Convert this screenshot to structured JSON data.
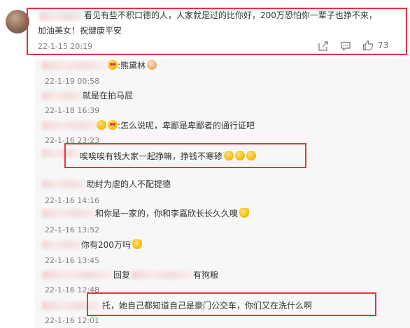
{
  "main_comment": {
    "text_line1": "看见有些不积口德的人，人家就是过的比你好，200万恐怕你一辈子也挣不来，",
    "text_line2": "加油美女！祝健康平安",
    "time": "22-1-15 20:19",
    "like_count": "73"
  },
  "replies": [
    {
      "text": ":熊黛林",
      "time": "22-1-19 00:58"
    },
    {
      "text": "就是在拍马屁",
      "time": "22-1-18 16:39"
    },
    {
      "text": ":怎么说呢，卑鄙是卑鄙者的通行证吧",
      "time": "22-1-16 23:23"
    },
    {
      "text": "唉唉唉有钱大家一起挣嘛，挣钱不寒碜",
      "time": ""
    },
    {
      "text": "助纣为虐的人不配提德",
      "time": "22-1-16 14:16"
    },
    {
      "text": "和你是一家的，你和李嘉欣长长久久噢",
      "time": "22-1-16 13:52"
    },
    {
      "text": "你有200万吗",
      "time": "22-1-16 13:45"
    },
    {
      "text_prefix": "回复",
      "text_suffix": "有狗粮",
      "time": "22-1-16 12:48"
    },
    {
      "text": "托，她自己都知道自己是豪门公交车，你们又在洗什么啊",
      "time": "22-1-16 12:01"
    }
  ],
  "colors": {
    "highlight_box": "#e8323c",
    "reply_bg": "#f7f7f7",
    "time_text": "#808080"
  },
  "icons": [
    "share-icon",
    "comment-icon",
    "like-icon"
  ]
}
